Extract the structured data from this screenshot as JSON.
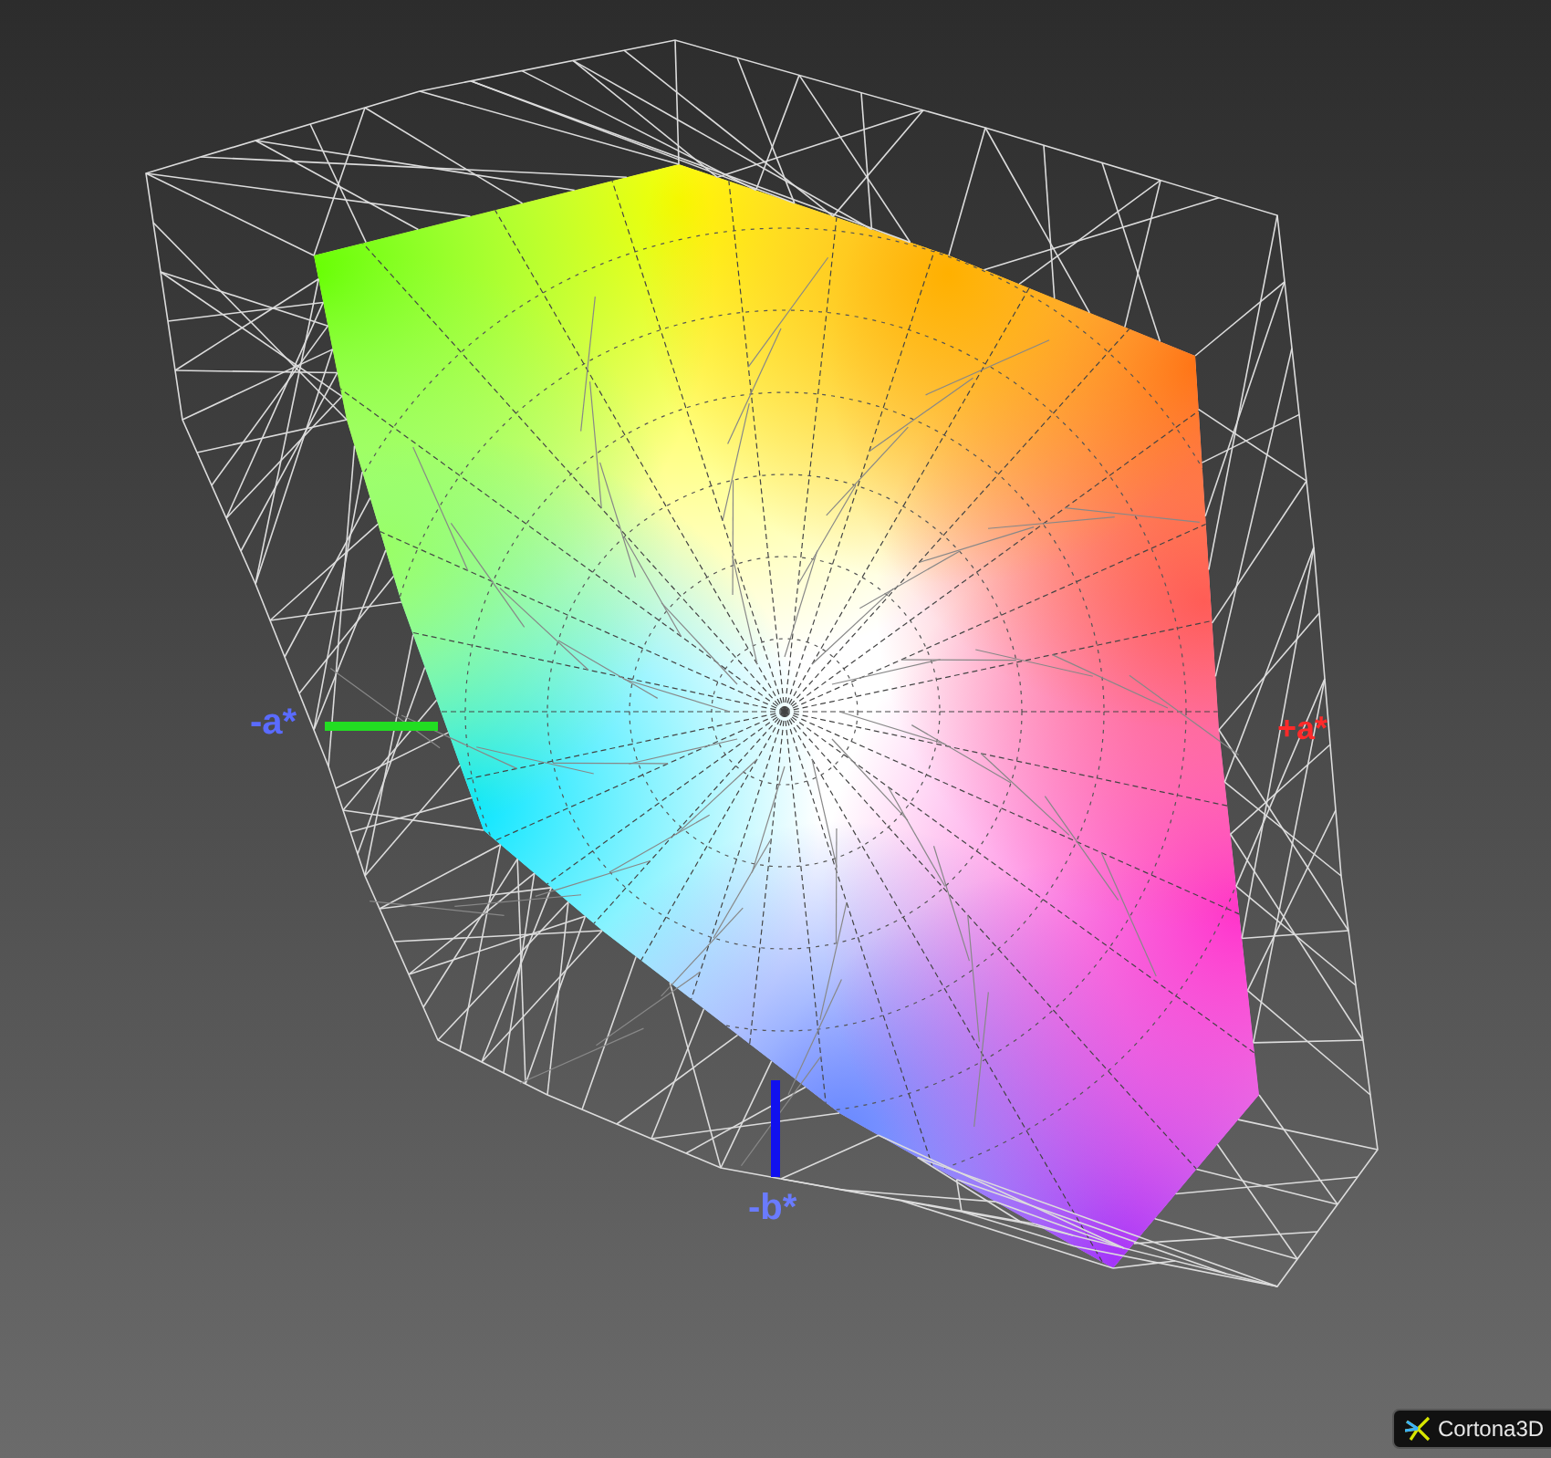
{
  "axis_labels": [
    {
      "text": "-a*",
      "kind": "neg_a"
    },
    {
      "text": "+a*",
      "kind": "pos_a"
    },
    {
      "text": "-b*",
      "kind": "neg_b"
    }
  ],
  "logo": {
    "text": "Cortona3D"
  }
}
